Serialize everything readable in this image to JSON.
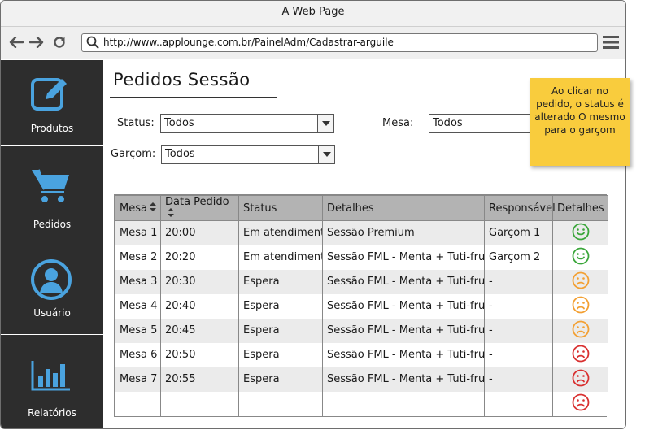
{
  "window": {
    "title": "A Web Page"
  },
  "browser": {
    "url": "http://www..applounge.com.br/PainelAdm/Cadastrar-arguile"
  },
  "sidebar": {
    "items": [
      {
        "label": "Produtos",
        "icon": "edit-icon"
      },
      {
        "label": "Pedidos",
        "icon": "cart-icon"
      },
      {
        "label": "Usuário",
        "icon": "user-icon"
      },
      {
        "label": "Relatórios",
        "icon": "bar-chart-icon"
      }
    ]
  },
  "main": {
    "title": "Pedidos Sessão",
    "filters": {
      "status_label": "Status:",
      "status_value": "Todos",
      "mesa_label": "Mesa:",
      "mesa_value": "Todos",
      "garcom_label": "Garçom:",
      "garcom_value": "Todos"
    },
    "note": "Ao clicar no pedido, o status é alterado O mesmo para o garçom"
  },
  "table": {
    "headers": [
      "Mesa",
      "Data Pedido",
      "Status",
      "Detalhes",
      "Responsável",
      "Detalhes"
    ],
    "rows": [
      {
        "mesa": "Mesa 1",
        "data": "20:00",
        "status": "Em atendimento",
        "detalhes": "Sessão Premium",
        "responsavel": "Garçom 1",
        "face": "happy",
        "color": "#3aa63a"
      },
      {
        "mesa": "Mesa 2",
        "data": "20:20",
        "status": "Em atendimento",
        "detalhes": "Sessão FML - Menta + Tuti-fruti",
        "responsavel": "Garçom 2",
        "face": "happy",
        "color": "#3aa63a"
      },
      {
        "mesa": "Mesa 3",
        "data": "20:30",
        "status": "Espera",
        "detalhes": "Sessão FML - Menta + Tuti-fruti",
        "responsavel": "-",
        "face": "sad",
        "color": "#f3a033"
      },
      {
        "mesa": "Mesa 4",
        "data": "20:40",
        "status": "Espera",
        "detalhes": "Sessão FML - Menta + Tuti-fruti",
        "responsavel": "-",
        "face": "sad",
        "color": "#f3a033"
      },
      {
        "mesa": "Mesa 5",
        "data": "20:45",
        "status": "Espera",
        "detalhes": "Sessão FML - Menta + Tuti-fruti",
        "responsavel": "-",
        "face": "sad",
        "color": "#f3a033"
      },
      {
        "mesa": "Mesa 6",
        "data": "20:50",
        "status": "Espera",
        "detalhes": "Sessão FML - Menta + Tuti-fruti",
        "responsavel": "-",
        "face": "sad",
        "color": "#d93030"
      },
      {
        "mesa": "Mesa 7",
        "data": "20:55",
        "status": "Espera",
        "detalhes": "Sessão FML - Menta + Tuti-fruti",
        "responsavel": "-",
        "face": "sad",
        "color": "#d93030"
      },
      {
        "mesa": "",
        "data": "",
        "status": "",
        "detalhes": "",
        "responsavel": "",
        "face": "sad",
        "color": "#d93030"
      }
    ]
  },
  "colors": {
    "sidebar_bg": "#2d2d2d",
    "icon_blue": "#4aa3df",
    "note_yellow": "#f9cc3d",
    "header_gray": "#b3b3b3"
  }
}
